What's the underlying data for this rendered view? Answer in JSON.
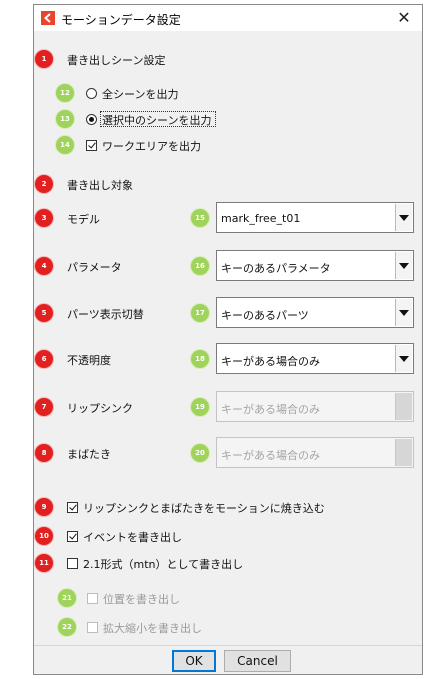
{
  "dialog": {
    "title": "モーションデータ設定",
    "close_symbol": "✕",
    "logo_icon": "app-logo-icon"
  },
  "badges": {
    "b1": "1",
    "b2": "2",
    "b3": "3",
    "b4": "4",
    "b5": "5",
    "b6": "6",
    "b7": "7",
    "b8": "8",
    "b9": "9",
    "b10": "10",
    "b11": "11",
    "b12": "12",
    "b13": "13",
    "b14": "14",
    "b15": "15",
    "b16": "16",
    "b17": "17",
    "b18": "18",
    "b19": "19",
    "b20": "20",
    "b21": "21",
    "b22": "22"
  },
  "export_scene": {
    "heading": "書き出しシーン設定",
    "all_scenes": "全シーンを出力",
    "selected_scenes": "選択中のシーンを出力",
    "work_area": "ワークエリアを出力",
    "selected": "selected_scenes",
    "work_area_checked": true
  },
  "targets": {
    "heading": "書き出し対象",
    "model_label": "モデル",
    "model_value": "mark_free_t01",
    "parameters_label": "パラメータ",
    "parameters_value": "キーのあるパラメータ",
    "parts_label": "パーツ表示切替",
    "parts_value": "キーのあるパーツ",
    "opacity_label": "不透明度",
    "opacity_value": "キーがある場合のみ",
    "lipsync_label": "リップシンク",
    "lipsync_value": "キーがある場合のみ",
    "blink_label": "まばたき",
    "blink_value": "キーがある場合のみ"
  },
  "options": {
    "bake_label": "リップシンクとまばたきをモーションに焼き込む",
    "bake_checked": true,
    "events_label": "イベントを書き出し",
    "events_checked": true,
    "mtn_label": "2.1形式（mtn）として書き出し",
    "mtn_checked": false,
    "position_label": "位置を書き出し",
    "scale_label": "拡大縮小を書き出し"
  },
  "footer": {
    "ok_label": "OK",
    "cancel_label": "Cancel"
  },
  "colors": {
    "badge_red": "#e32020",
    "badge_green": "#9fd35b",
    "accent": "#0078d7"
  }
}
